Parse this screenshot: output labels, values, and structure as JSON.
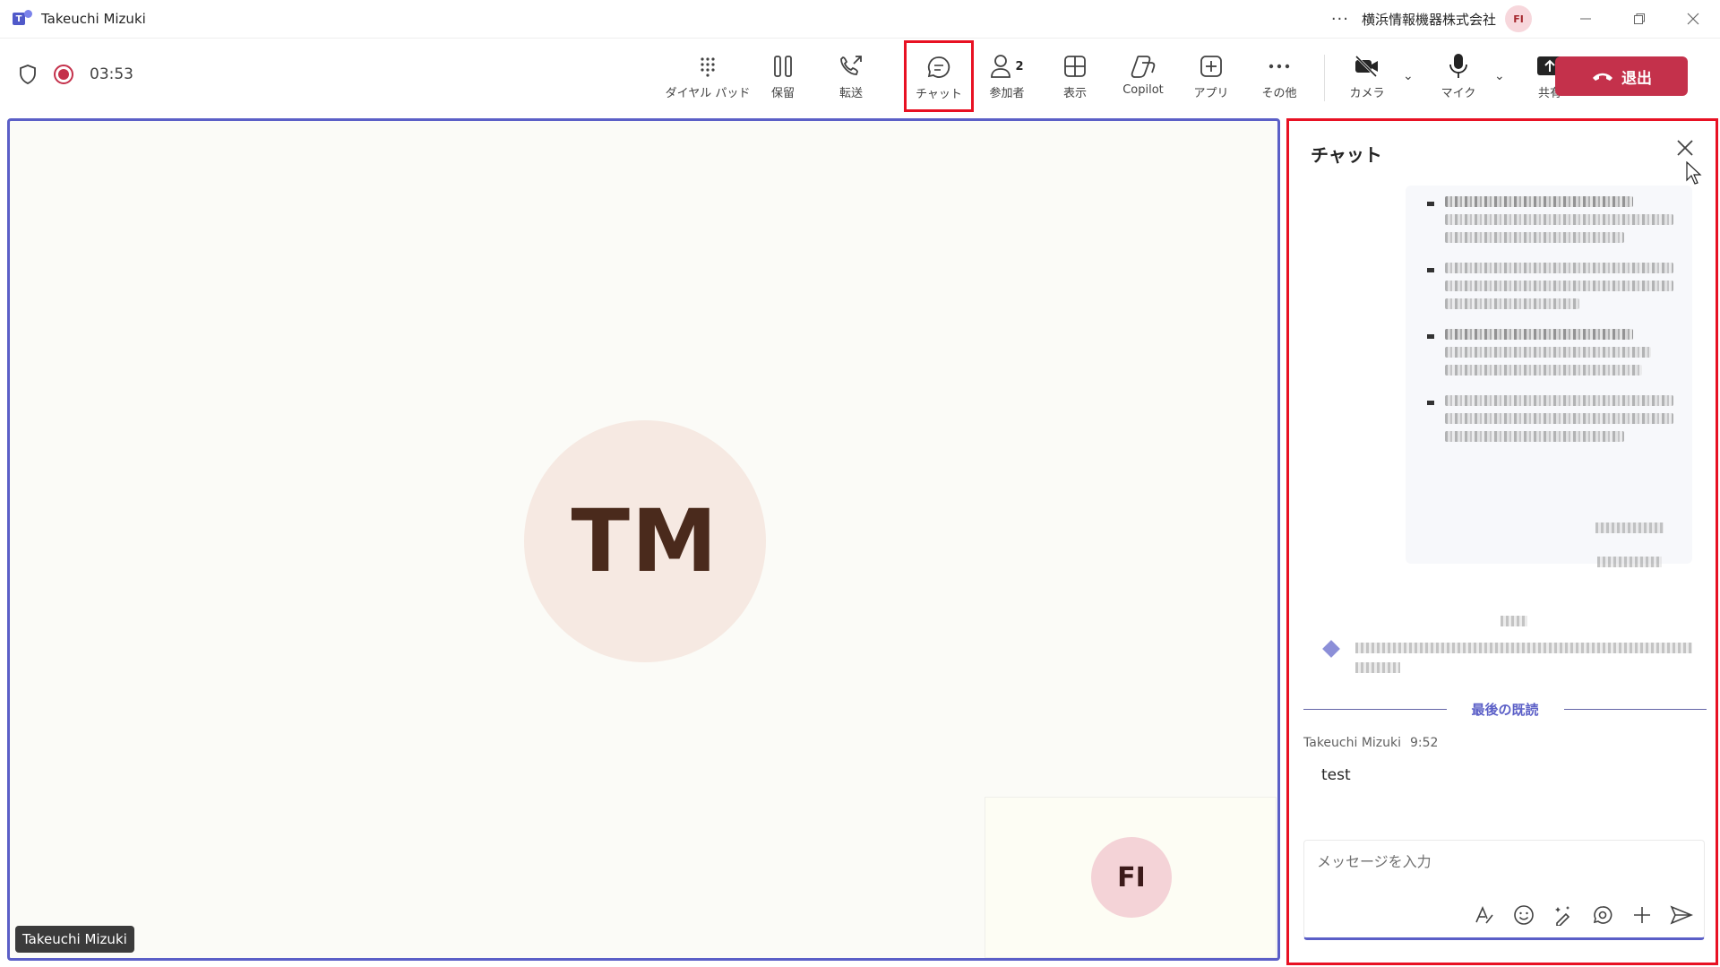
{
  "window": {
    "title": "Takeuchi Mizuki",
    "org_name": "横浜情報機器株式会社",
    "org_avatar": "FI",
    "more": "···"
  },
  "toolbar": {
    "timer": "03:53",
    "items": [
      {
        "label": "ダイヤル パッド",
        "icon": "dialpad-icon"
      },
      {
        "label": "保留",
        "icon": "pause-icon"
      },
      {
        "label": "転送",
        "icon": "transfer-call-icon"
      },
      {
        "label": "チャット",
        "icon": "chat-icon",
        "active": true
      },
      {
        "label": "参加者",
        "icon": "people-icon",
        "count": "2"
      },
      {
        "label": "表示",
        "icon": "grid-view-icon"
      },
      {
        "label": "Copilot",
        "icon": "copilot-icon"
      },
      {
        "label": "アプリ",
        "icon": "add-app-icon"
      },
      {
        "label": "その他",
        "icon": "more-icon"
      },
      {
        "label": "カメラ",
        "icon": "camera-off-icon"
      },
      {
        "label": "マイク",
        "icon": "mic-icon"
      },
      {
        "label": "共有",
        "icon": "share-screen-icon"
      }
    ],
    "leave_label": "退出"
  },
  "stage": {
    "remote_initials": "TM",
    "self_initials": "FI",
    "name_tag": "Takeuchi Mizuki"
  },
  "chat": {
    "title": "チャット",
    "last_read": "最後の既読",
    "sender": "Takeuchi Mizuki",
    "time": "9:52",
    "message": "test",
    "placeholder": "メッセージを入力"
  },
  "colors": {
    "accent": "#5b5fc7",
    "leave": "#c4314b",
    "highlight": "#e81123"
  }
}
